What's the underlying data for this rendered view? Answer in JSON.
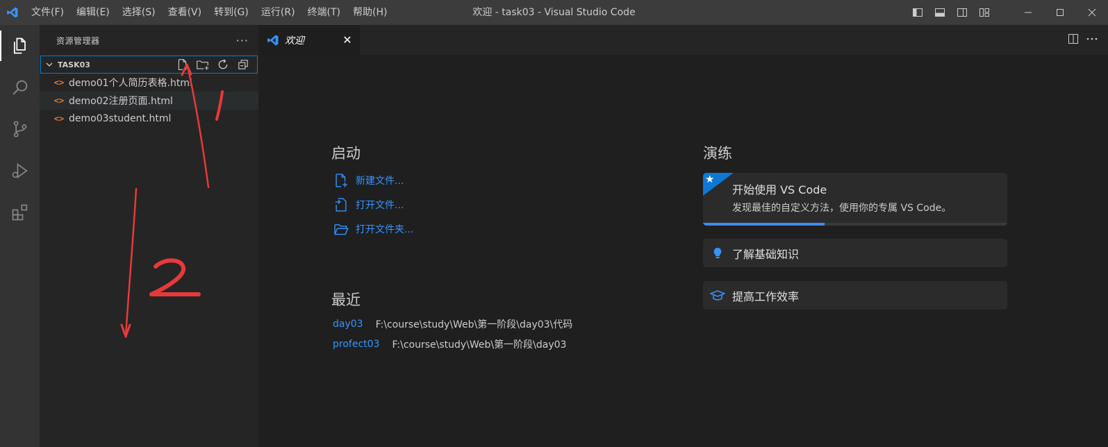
{
  "titlebar": {
    "menu": [
      "文件(F)",
      "编辑(E)",
      "选择(S)",
      "查看(V)",
      "转到(G)",
      "运行(R)",
      "终端(T)",
      "帮助(H)"
    ],
    "window_title": "欢迎 - task03 - Visual Studio Code"
  },
  "activitybar": {
    "items": [
      "files-icon",
      "search-icon",
      "source-control-icon",
      "run-debug-icon",
      "extensions-icon"
    ]
  },
  "sidebar": {
    "title": "资源管理器",
    "more": "···",
    "folder": "TASK03",
    "files": [
      "demo01个人简历表格.html",
      "demo02注册页面.html",
      "demo03student.html"
    ],
    "file_icon": "<>"
  },
  "tab": {
    "label": "欢迎",
    "close": "✕"
  },
  "welcome": {
    "start_title": "启动",
    "start_items": [
      "新建文件...",
      "打开文件...",
      "打开文件夹..."
    ],
    "recent_title": "最近",
    "recent": [
      {
        "name": "day03",
        "path": "F:\\course\\study\\Web\\第一阶段\\day03\\代码"
      },
      {
        "name": "profect03",
        "path": "F:\\course\\study\\Web\\第一阶段\\day03"
      }
    ],
    "walkthrough_title": "演练",
    "featured": {
      "title": "开始使用 VS Code",
      "desc": "发现最佳的自定义方法，使用你的专属 VS Code。",
      "progress": 0.4
    },
    "items": [
      "了解基础知识",
      "提高工作效率"
    ]
  },
  "colors": {
    "accent": "#3794ff",
    "annotation": "#e8393a"
  }
}
